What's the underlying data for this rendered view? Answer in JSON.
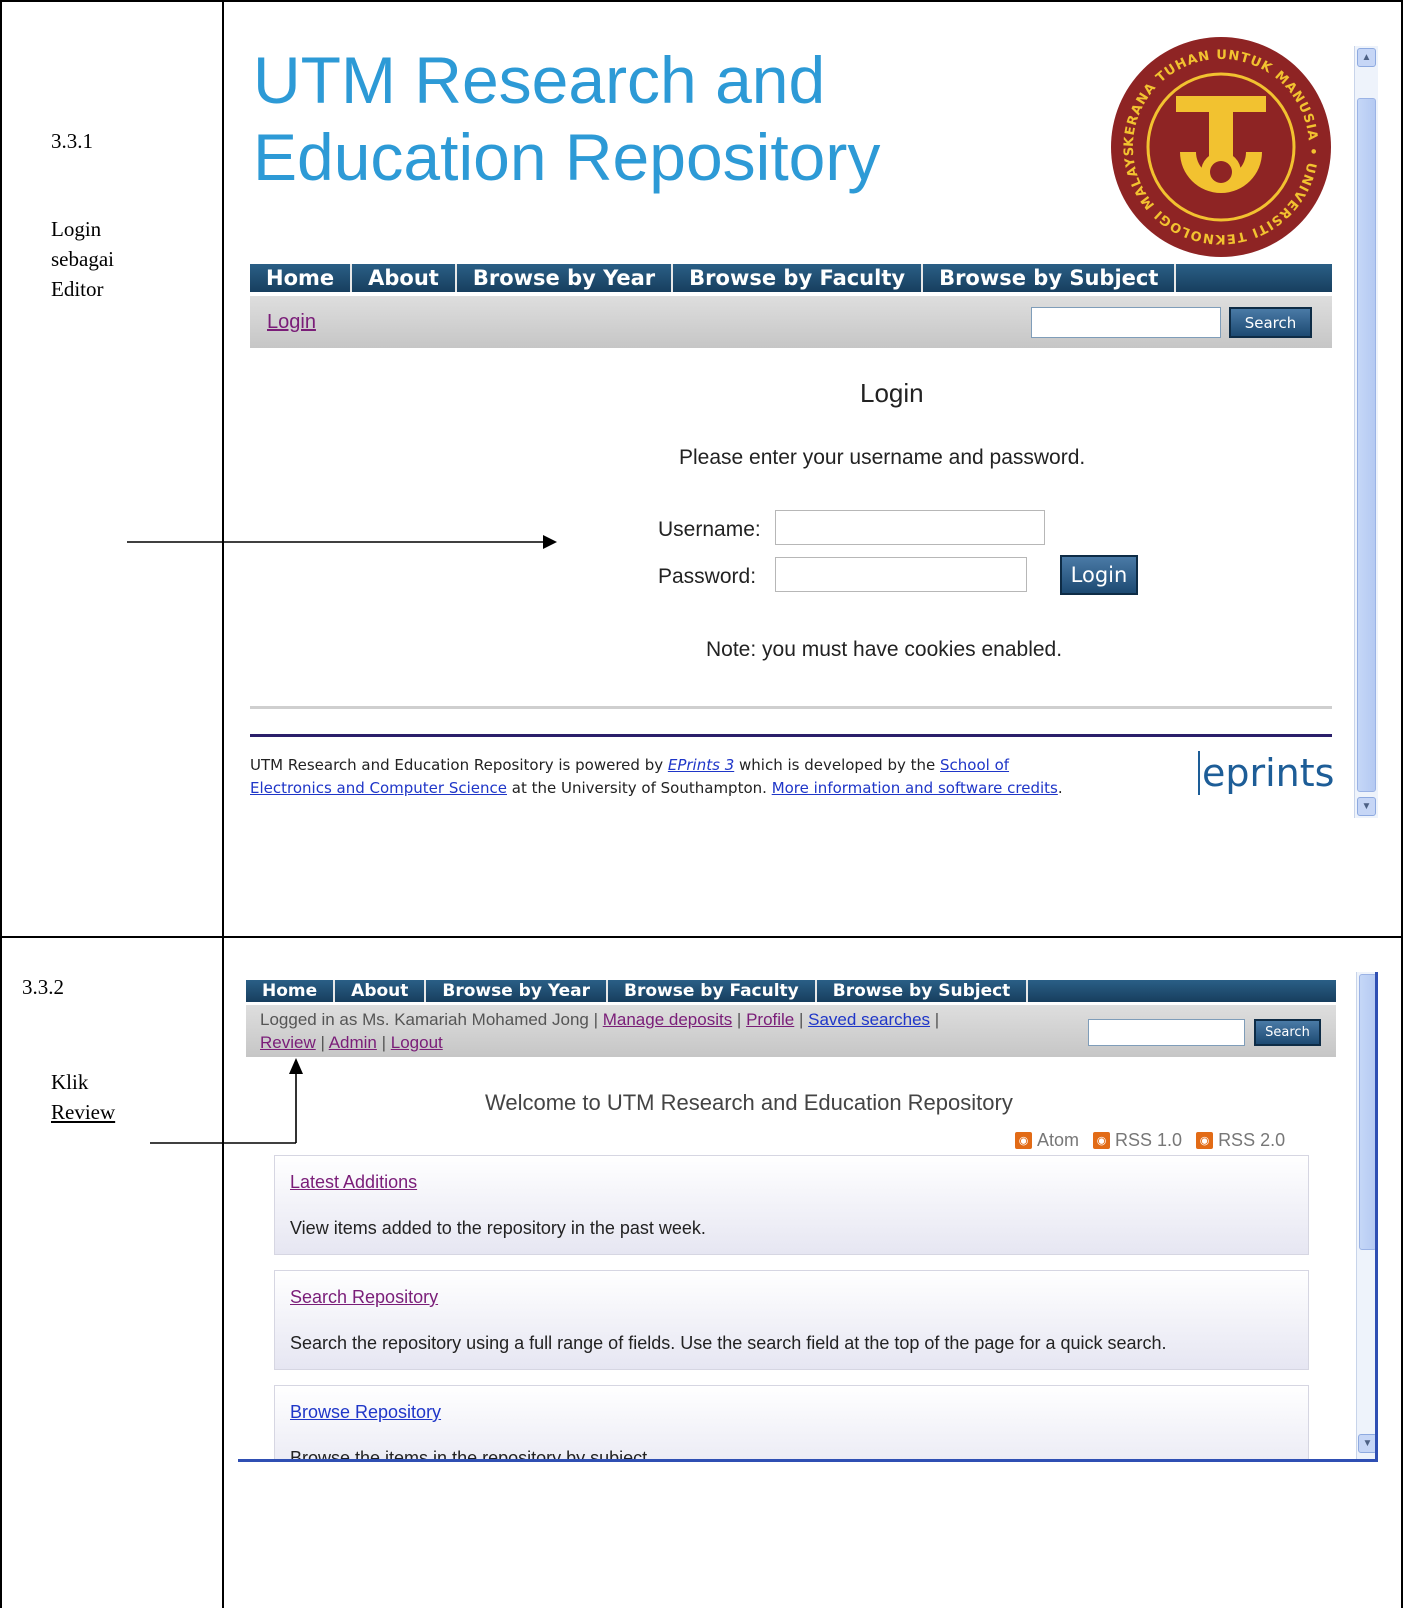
{
  "section1": {
    "number": "3.3.1",
    "label": "Login\nsebagai\nEditor",
    "site_title_line1": "UTM Research and",
    "site_title_line2": "Education Repository",
    "logo": {
      "ring_text": "KERANA TUHAN UNTUK MANUSIA • UNIVERSITI TEKNOLOGI MALAYSIA",
      "colors": {
        "ring": "#8e2424",
        "gold": "#f2c230"
      }
    },
    "menu": [
      "Home",
      "About",
      "Browse by Year",
      "Browse by Faculty",
      "Browse by Subject"
    ],
    "login_link": "Login",
    "search_button": "Search",
    "heading": "Login",
    "instructions": "Please enter your username and password.",
    "username_label": "Username:",
    "password_label": "Password:",
    "login_button": "Login",
    "note": "Note: you must have cookies enabled.",
    "footer": {
      "t1": "UTM Research and Education Repository is powered by ",
      "eprints_link": "EPrints 3",
      "t2": " which is developed by the ",
      "school_link_1": "School of",
      "school_link_2": "Electronics and Computer Science",
      "t3": " at the University of Southampton. ",
      "credits_link": "More information and software credits",
      "t4": ".",
      "logo_text": "eprints"
    }
  },
  "section2": {
    "number": "3.3.2",
    "label_line1": "Klik",
    "label_line2": "Review",
    "menu": [
      "Home",
      "About",
      "Browse by Year",
      "Browse by Faculty",
      "Browse by Subject"
    ],
    "logged_in_text": "Logged in as Ms. Kamariah Mohamed Jong | ",
    "links": {
      "manage": "Manage deposits",
      "profile": "Profile",
      "saved": "Saved searches",
      "review": "Review",
      "admin": "Admin",
      "logout": "Logout"
    },
    "sep": " | ",
    "search_button": "Search",
    "welcome": "Welcome to UTM Research and Education Repository",
    "feeds": [
      "Atom",
      "RSS 1.0",
      "RSS 2.0"
    ],
    "boxes": [
      {
        "title": "Latest Additions",
        "desc": "View items added to the repository in the past week."
      },
      {
        "title": "Search Repository",
        "desc": "Search the repository using a full range of fields. Use the search field at the top of the page for a quick search."
      },
      {
        "title": "Browse Repository",
        "desc": "Browse the items in the repository by subject."
      }
    ]
  },
  "colors": {
    "title_blue": "#2d9ad6",
    "menu_blue": "#1f4e74",
    "link_purple": "#7a1d78",
    "footer_rule": "#2a1f6a"
  }
}
